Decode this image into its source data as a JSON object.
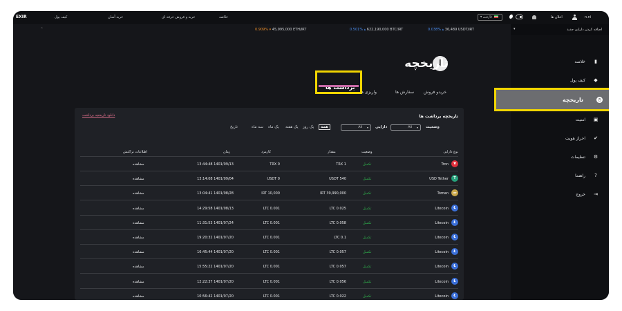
{
  "topbar": {
    "logo": "EXIR",
    "nav": [
      "کیف پول",
      "خرید آسان",
      "خرید و فروش حرفه ای",
      "خلاصه"
    ],
    "language": "فارسی",
    "notifications_label": "اعلان ها",
    "username": "n.ni",
    "menu_label": "m.ni"
  },
  "ticker": [
    {
      "pair": "45,995,000 ETH/IRT",
      "change": "0.909%",
      "dir": "neg"
    },
    {
      "pair": "622,190,000 BTC/IRT",
      "change": "0.501%",
      "dir": "pos"
    },
    {
      "pair": "36,489 USDT/IRT",
      "change": "0.038%",
      "dir": "pos"
    }
  ],
  "sidebar": {
    "add_asset": "اضافه کردن دارایی جدید",
    "items": [
      {
        "label": "خلاصه",
        "icon": "bar-chart-icon",
        "glyph": "▮"
      },
      {
        "label": "کیف پول",
        "icon": "wallet-icon",
        "glyph": "◆"
      },
      {
        "label": "تاریخچه",
        "icon": "clock-icon",
        "glyph": "◷"
      },
      {
        "label": "امنیت",
        "icon": "lock-icon",
        "glyph": "▣"
      },
      {
        "label": "احراز هویت",
        "icon": "check-circle-icon",
        "glyph": "✔"
      },
      {
        "label": "تنظیمات",
        "icon": "gear-icon",
        "glyph": "⚙"
      },
      {
        "label": "راهنما",
        "icon": "help-icon",
        "glyph": "?"
      },
      {
        "label": "خروج",
        "icon": "logout-icon",
        "glyph": "⇥"
      }
    ]
  },
  "page": {
    "title": "تاریخچه",
    "tabs": [
      "خریدو فروش",
      "سفارش ها",
      "واریزی ها",
      "برداشت ها"
    ]
  },
  "panel": {
    "title": "تاریخچه برداشت ها",
    "download": "دانلود تاریخچه برداشت",
    "filters": {
      "status_label": "وضعیت",
      "status_value": "All",
      "asset_label": "دارایی",
      "asset_value": "All",
      "ranges": [
        "همه",
        "یک روز",
        "یک هفته",
        "یک ماه",
        "سه ماه"
      ],
      "date_label": "تاریخ"
    },
    "columns": [
      "نوع دارایی",
      "وضعیت",
      "مقدار",
      "کارمزد",
      "زمان",
      "اطلاعات تراکنش"
    ],
    "rows": [
      {
        "coin": "Tron",
        "status": "تکمیل",
        "amount": "TRX 1",
        "fee": "TRX 0",
        "time": "13:44:48 1401/09/13",
        "action": "مشاهده",
        "icon_color": "#e0303c",
        "glyph": "▼"
      },
      {
        "coin": "USD Tether",
        "status": "تکمیل",
        "amount": "USDT 540",
        "fee": "USDT 0",
        "time": "13:14:08 1401/09/04",
        "action": "مشاهده",
        "icon_color": "#26a17b",
        "glyph": "T"
      },
      {
        "coin": "Toman",
        "status": "تکمیل",
        "amount": "IRT 39,990,000",
        "fee": "IRT 10,000",
        "time": "13:04:41 1401/08/28",
        "action": "مشاهده",
        "icon_color": "#c8a64a",
        "glyph": "IRT"
      },
      {
        "coin": "Litecoin",
        "status": "تکمیل",
        "amount": "LTC 0.025",
        "fee": "LTC 0.001",
        "time": "14:29:58 1401/08/13",
        "action": "مشاهده",
        "icon_color": "#3b6fd8",
        "glyph": "Ł"
      },
      {
        "coin": "Litecoin",
        "status": "تکمیل",
        "amount": "LTC 0.058",
        "fee": "LTC 0.001",
        "time": "11:31:53 1401/07/24",
        "action": "مشاهده",
        "icon_color": "#3b6fd8",
        "glyph": "Ł"
      },
      {
        "coin": "Litecoin",
        "status": "تکمیل",
        "amount": "LTC 0.1",
        "fee": "LTC 0.001",
        "time": "19:20:32 1401/07/20",
        "action": "مشاهده",
        "icon_color": "#3b6fd8",
        "glyph": "Ł"
      },
      {
        "coin": "Litecoin",
        "status": "تکمیل",
        "amount": "LTC 0.057",
        "fee": "LTC 0.001",
        "time": "16:45:44 1401/07/20",
        "action": "مشاهده",
        "icon_color": "#3b6fd8",
        "glyph": "Ł"
      },
      {
        "coin": "Litecoin",
        "status": "تکمیل",
        "amount": "LTC 0.057",
        "fee": "LTC 0.001",
        "time": "15:55:22 1401/07/20",
        "action": "مشاهده",
        "icon_color": "#3b6fd8",
        "glyph": "Ł"
      },
      {
        "coin": "Litecoin",
        "status": "تکمیل",
        "amount": "LTC 0.056",
        "fee": "LTC 0.001",
        "time": "12:22:37 1401/07/20",
        "action": "مشاهده",
        "icon_color": "#3b6fd8",
        "glyph": "Ł"
      },
      {
        "coin": "Litecoin",
        "status": "تکمیل",
        "amount": "LTC 0.022",
        "fee": "LTC 0.001",
        "time": "10:56:42 1401/07/20",
        "action": "مشاهده",
        "icon_color": "#3b6fd8",
        "glyph": "Ł"
      }
    ]
  }
}
